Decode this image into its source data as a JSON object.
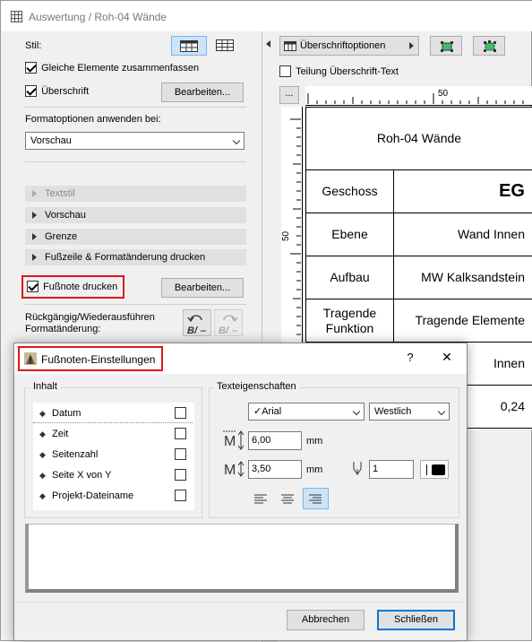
{
  "window": {
    "title": "Auswertung / Roh-04 Wände"
  },
  "left_panel": {
    "stil_label": "Stil:",
    "chk_gleiche": "Gleiche Elemente zusammenfassen",
    "chk_ueberschrift": "Überschrift",
    "bearbeiten1": "Bearbeiten...",
    "format_label": "Formatoptionen anwenden bei:",
    "format_select": "Vorschau",
    "sections": [
      "Textstil",
      "Vorschau",
      "Grenze",
      "Fußzeile & Formatänderung drucken"
    ],
    "chk_fussnote": "Fußnote drucken",
    "bearbeiten2": "Bearbeiten...",
    "undo_label": "Rückgängig/Wiederausführen Formatänderung:"
  },
  "right_panel": {
    "header_options": "Überschriftoptionen",
    "teilung": "Teilung Überschrift-Text",
    "ruler_btn": "...",
    "ruler_h_label": "50",
    "ruler_v_label": "50"
  },
  "table": {
    "title": "Roh-04 Wände",
    "rows": [
      {
        "label": "Geschoss",
        "value": "EG"
      },
      {
        "label": "Ebene",
        "value": "Wand Innen"
      },
      {
        "label": "Aufbau",
        "value": "MW Kalksandstein"
      },
      {
        "label": "Tragende Funktion",
        "value": "Tragende Elemente"
      },
      {
        "label": "",
        "value": "Innen"
      },
      {
        "label": "",
        "value": "0,24"
      }
    ]
  },
  "dialog": {
    "title": "Fußnoten-Einstellungen",
    "help": "?",
    "close": "✕",
    "inhalt_label": "Inhalt",
    "items": [
      "Datum",
      "Zeit",
      "Seitenzahl",
      "Seite X von Y",
      "Projekt-Dateiname"
    ],
    "text_label": "Texteigenschaften",
    "font": "Arial",
    "script": "Westlich",
    "size1": "6,00",
    "size2": "3,50",
    "unit": "mm",
    "pen": "1",
    "cancel": "Abbrechen",
    "ok": "Schließen"
  }
}
